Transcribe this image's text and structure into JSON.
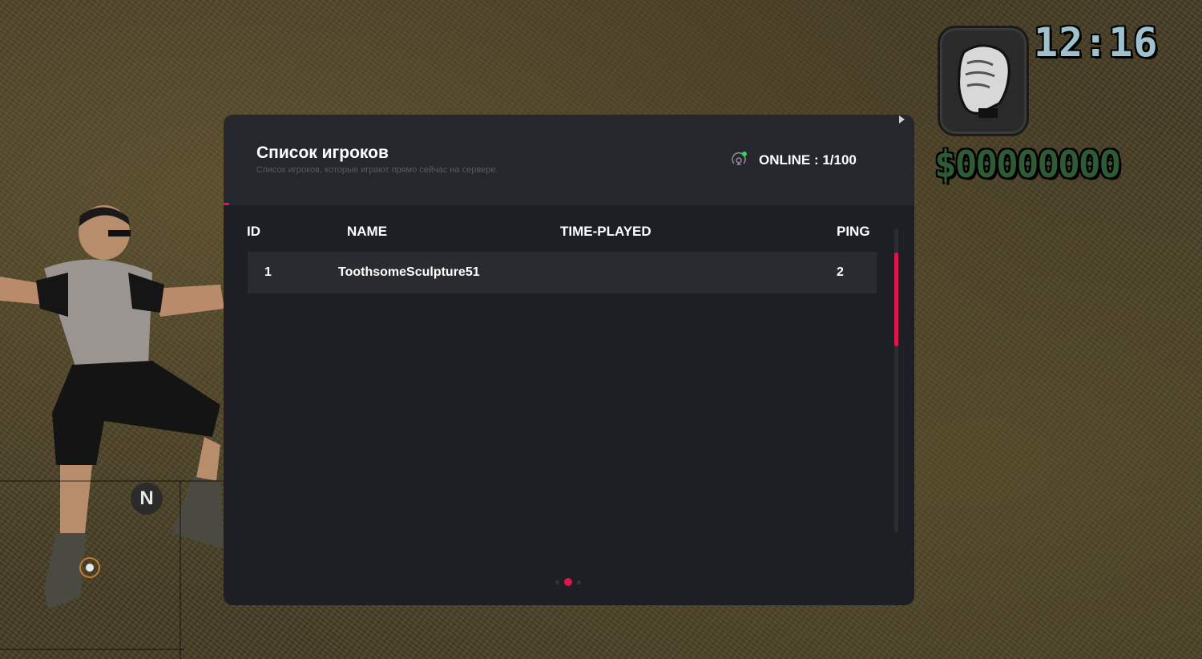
{
  "hud": {
    "clock": "12:16",
    "money": "$00000000",
    "weapon_icon": "fist-icon",
    "radar_north": "N"
  },
  "panel": {
    "title": "Список игроков",
    "subtitle": "Список игроков, которые играют прямо сейчас на сервере.",
    "online_label": "ONLINE : 1/100",
    "accent_color": "#e0154a",
    "online_indicator_color": "#35d35a",
    "columns": {
      "id": "ID",
      "name": "NAME",
      "time_played": "TIME-PLAYED",
      "ping": "PING"
    },
    "rows": [
      {
        "id": "1",
        "name": "ToothsomeSculpture51",
        "time_played": "",
        "ping": "2"
      }
    ],
    "pagination": {
      "pages": 3,
      "active_page": 2
    }
  }
}
